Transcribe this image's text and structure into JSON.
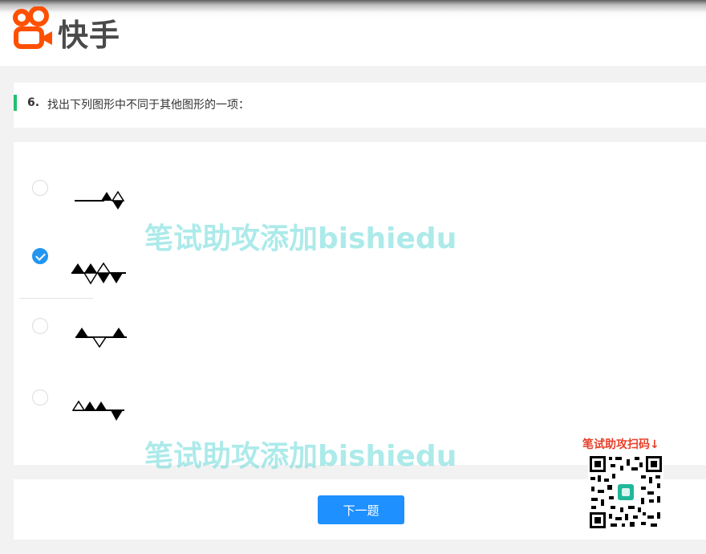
{
  "header": {
    "brand_name": "快手",
    "logo_color": "#ff5000"
  },
  "question": {
    "number": "6.",
    "text": "找出下列图形中不同于其他图形的一项：",
    "accent_color": "#22c06e"
  },
  "options": [
    {
      "id": "A",
      "selected": false
    },
    {
      "id": "B",
      "selected": true
    },
    {
      "id": "C",
      "selected": false
    },
    {
      "id": "D",
      "selected": false
    }
  ],
  "footer": {
    "next_label": "下一题",
    "button_color": "#1e90ff"
  },
  "overlay": {
    "watermark_text": "笔试助攻添加bishiedu",
    "qr_caption": "笔试助攻扫码↓"
  }
}
